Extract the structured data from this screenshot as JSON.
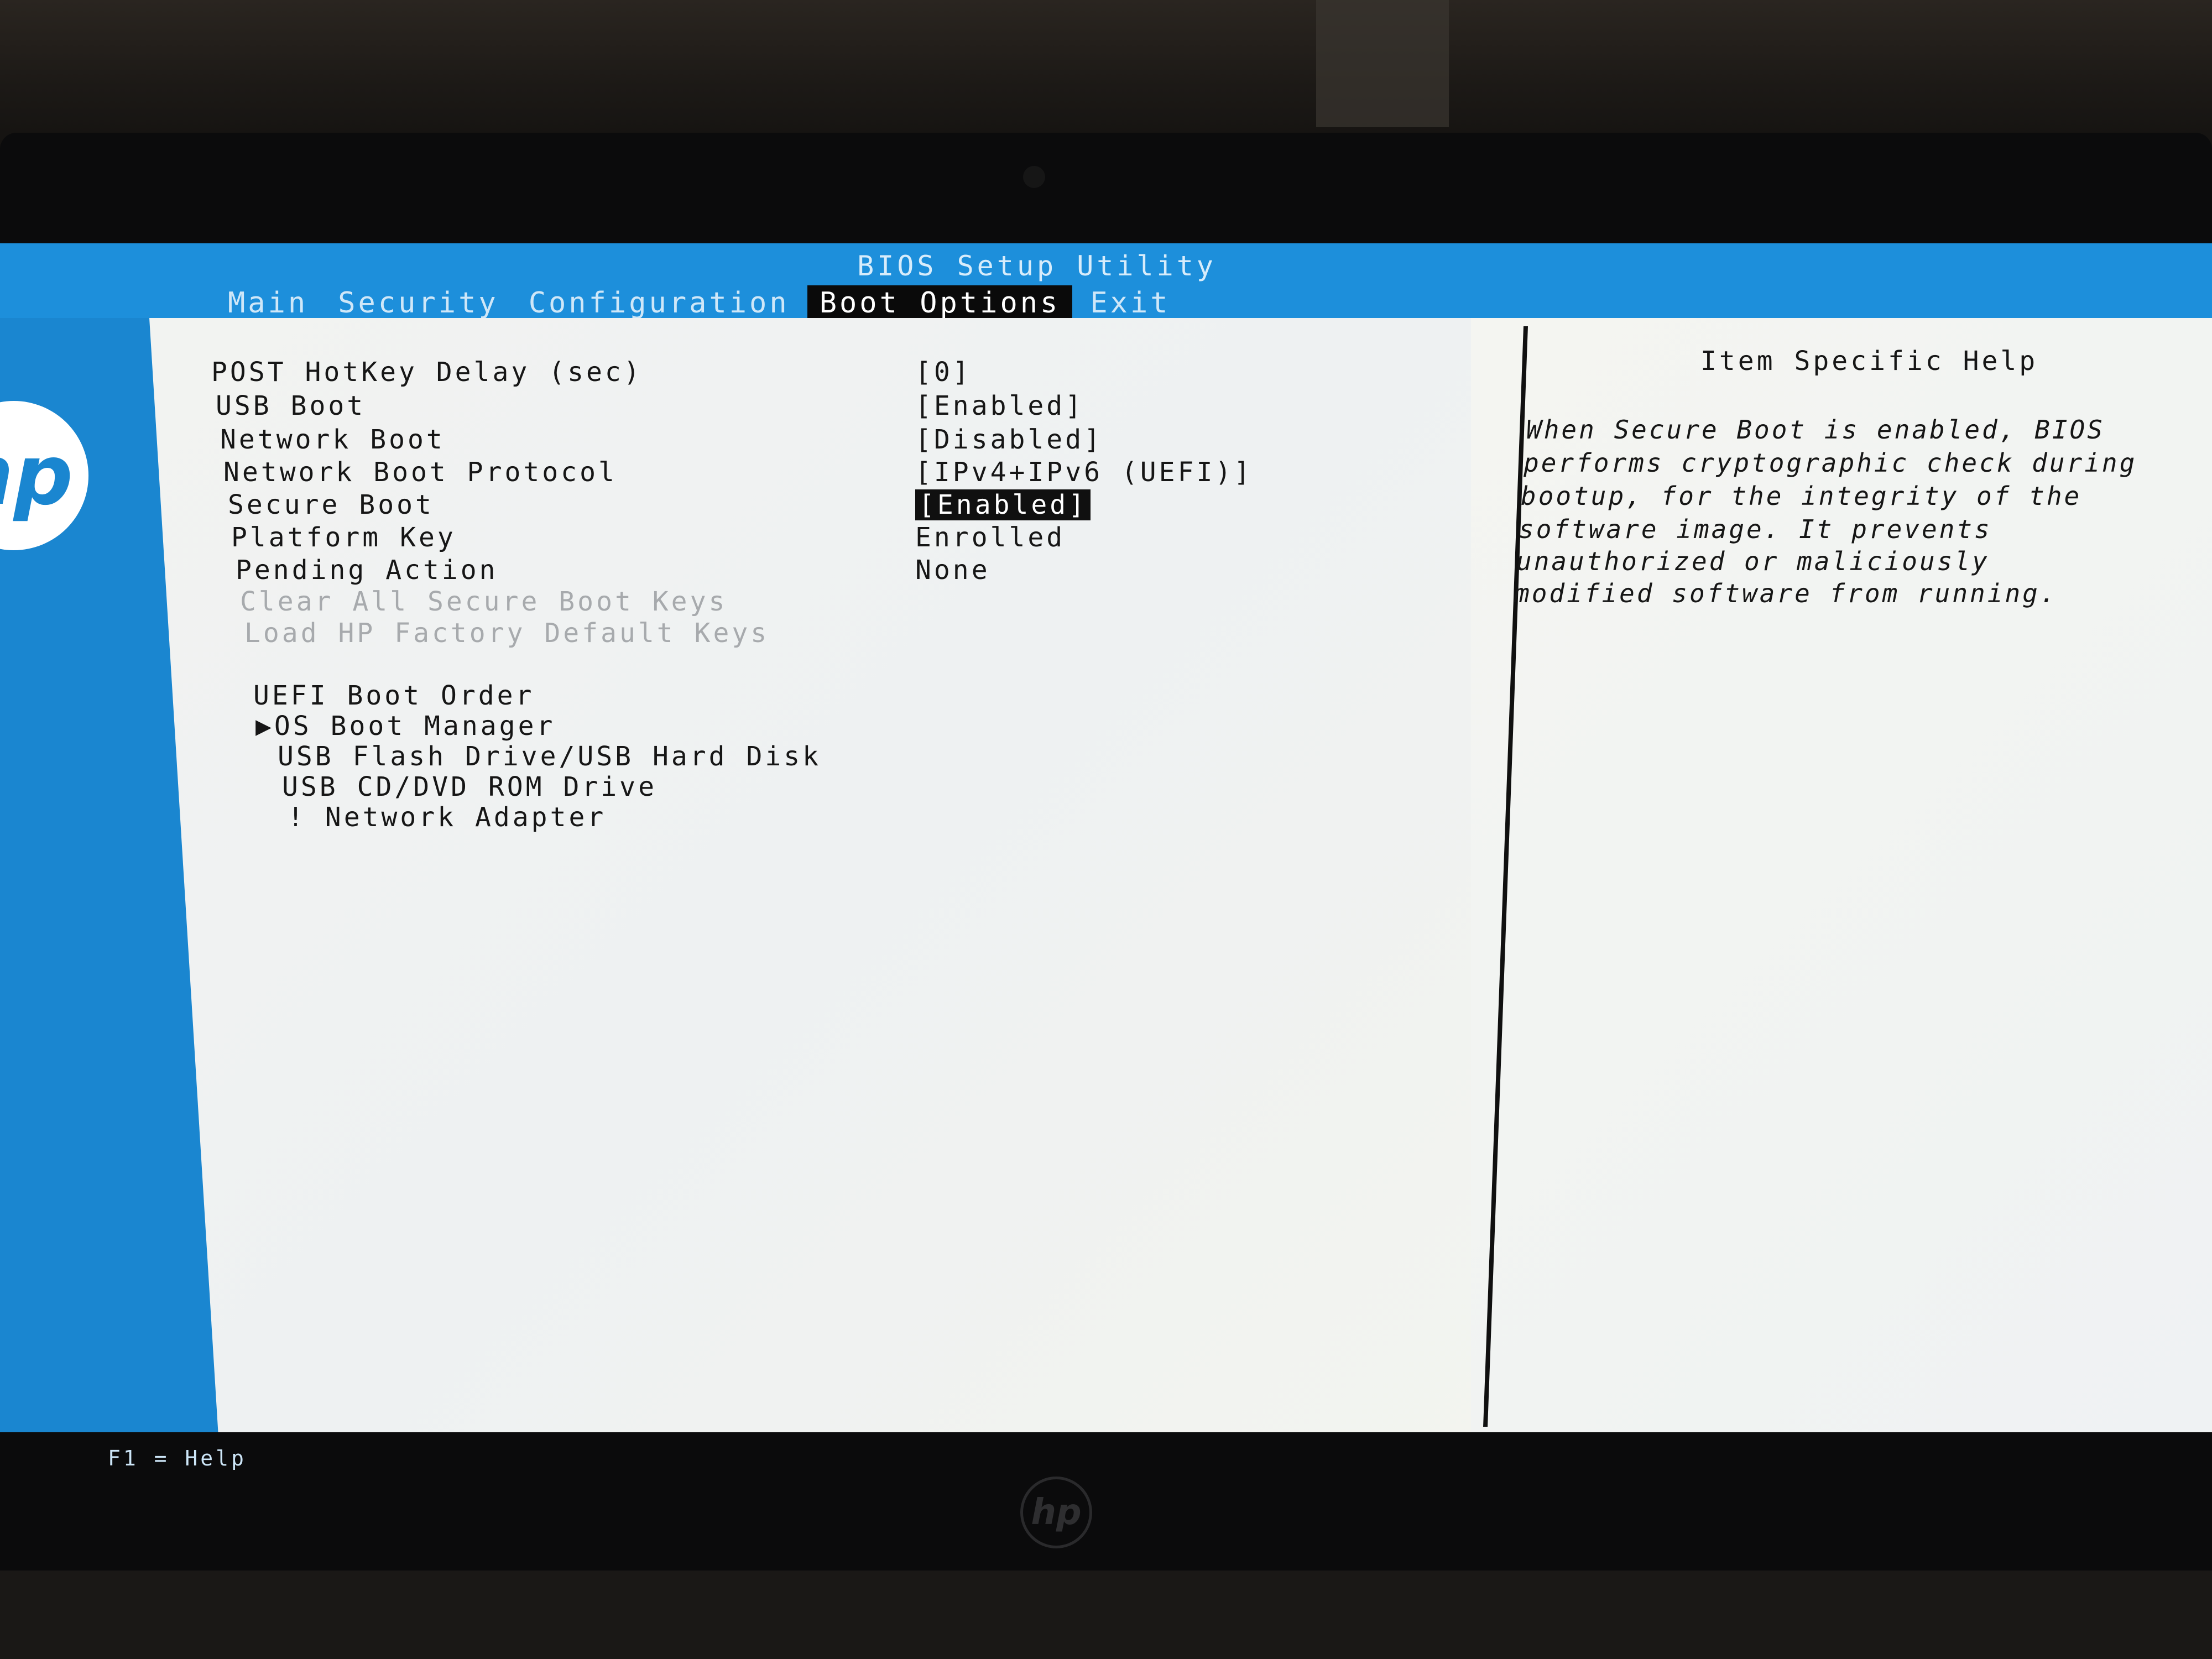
{
  "bios": {
    "title": "BIOS Setup Utility",
    "menu": [
      "Main",
      "Security",
      "Configuration",
      "Boot Options",
      "Exit"
    ],
    "active_menu": "Boot Options",
    "settings": [
      {
        "label": "POST HotKey Delay (sec)",
        "value": "[0]"
      },
      {
        "label": "USB Boot",
        "value": "[Enabled]"
      },
      {
        "label": "Network Boot",
        "value": "[Disabled]"
      },
      {
        "label": "Network Boot Protocol",
        "value": "[IPv4+IPv6 (UEFI)]"
      },
      {
        "label": "Secure Boot",
        "value": "[Enabled]"
      },
      {
        "label": "Platform Key",
        "value": "Enrolled"
      },
      {
        "label": "Pending Action",
        "value": "None"
      },
      {
        "label": "Clear All Secure Boot Keys",
        "value": ""
      },
      {
        "label": "Load HP Factory Default Keys",
        "value": ""
      }
    ],
    "selected_setting": "Secure Boot",
    "boot_order": {
      "heading": "UEFI Boot Order",
      "items": [
        "▶OS Boot Manager",
        "USB Flash Drive/USB Hard Disk",
        "USB CD/DVD ROM Drive",
        "! Network Adapter"
      ]
    },
    "help": {
      "title": "Item Specific Help",
      "lines": [
        "When Secure Boot is enabled, BIOS",
        "performs cryptographic check during",
        "bootup, for the integrity of the",
        "software image. It prevents",
        "unauthorized or maliciously",
        "modified software from running."
      ]
    },
    "footer_help": "F1 = Help",
    "logo_text": "hp"
  },
  "colors": {
    "header_blue": "#1d8fdb",
    "panel_bg": "#f2f3f1",
    "selection_bg": "#101010",
    "disabled_text": "#a7aaad"
  }
}
